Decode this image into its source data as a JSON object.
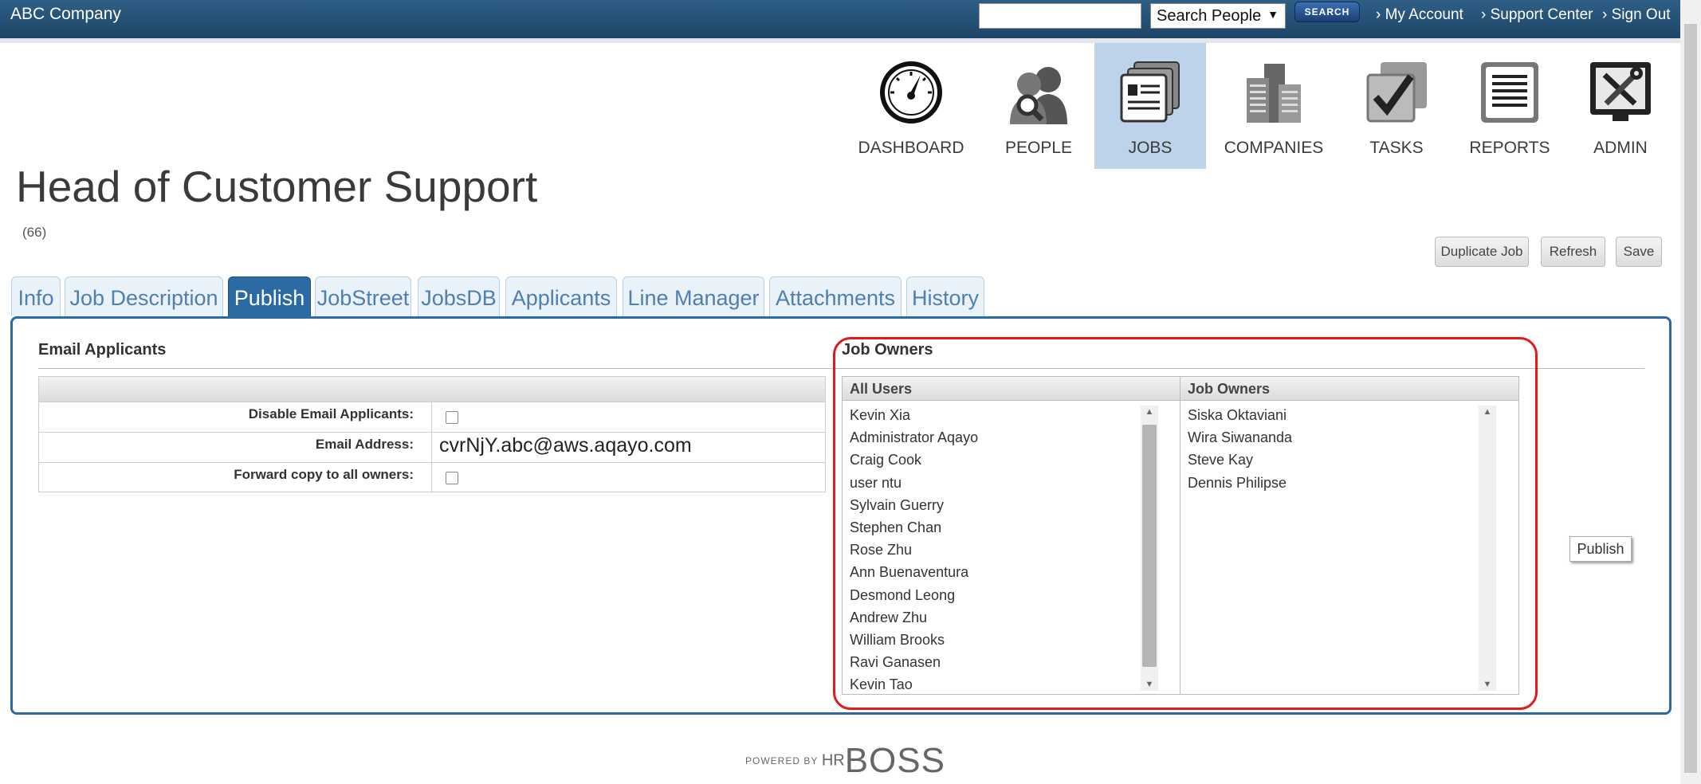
{
  "topbar": {
    "brand": "ABC Company",
    "search_select": "Search People",
    "search_button": "SEARCH",
    "links": [
      "› My Account",
      "› Support Center",
      "› Sign Out"
    ]
  },
  "nav": [
    {
      "label": "DASHBOARD",
      "icon": "dashboard-gauge-icon"
    },
    {
      "label": "PEOPLE",
      "icon": "people-icon"
    },
    {
      "label": "JOBS",
      "icon": "jobs-cards-icon",
      "active": true
    },
    {
      "label": "COMPANIES",
      "icon": "companies-buildings-icon"
    },
    {
      "label": "TASKS",
      "icon": "tasks-checkbox-icon"
    },
    {
      "label": "REPORTS",
      "icon": "reports-document-icon"
    },
    {
      "label": "ADMIN",
      "icon": "admin-tools-icon"
    }
  ],
  "page": {
    "title": "Head of Customer Support",
    "count": "(66)"
  },
  "actions": [
    "Duplicate Job",
    "Refresh",
    "Save"
  ],
  "tabs": [
    "Info",
    "Job Description",
    "Publish",
    "JobStreet",
    "JobsDB",
    "Applicants",
    "Line Manager",
    "Attachments",
    "History"
  ],
  "active_tab": "Publish",
  "email": {
    "title": "Email Applicants",
    "disable_label": "Disable Email Applicants:",
    "address_label": "Email Address:",
    "address_value": "cvrNjY.abc@aws.aqayo.com",
    "forward_label": "Forward copy to all owners:"
  },
  "owners": {
    "title": "Job Owners",
    "all_users_header": "All Users",
    "job_owners_header": "Job Owners",
    "all_users": [
      "Kevin Xia",
      "Administrator Aqayo",
      "Craig Cook",
      "user ntu",
      "Sylvain Guerry",
      "Stephen Chan",
      "Rose Zhu",
      "Ann Buenaventura",
      "Desmond Leong",
      "Andrew Zhu",
      "William Brooks",
      "Ravi Ganasen",
      "Kevin Tao"
    ],
    "job_owners": [
      "Siska Oktaviani",
      "Wira Siwananda",
      "Steve Kay",
      "Dennis Philipse"
    ]
  },
  "publish_button": "Publish",
  "footer": {
    "powered": "POWERED BY",
    "hr": "HR",
    "boss": "BOSS"
  },
  "colors": {
    "topbar": "#1d4466",
    "accent": "#2b6aa2",
    "active_nav": "#bcd3ea",
    "highlight": "#e01b1b"
  }
}
